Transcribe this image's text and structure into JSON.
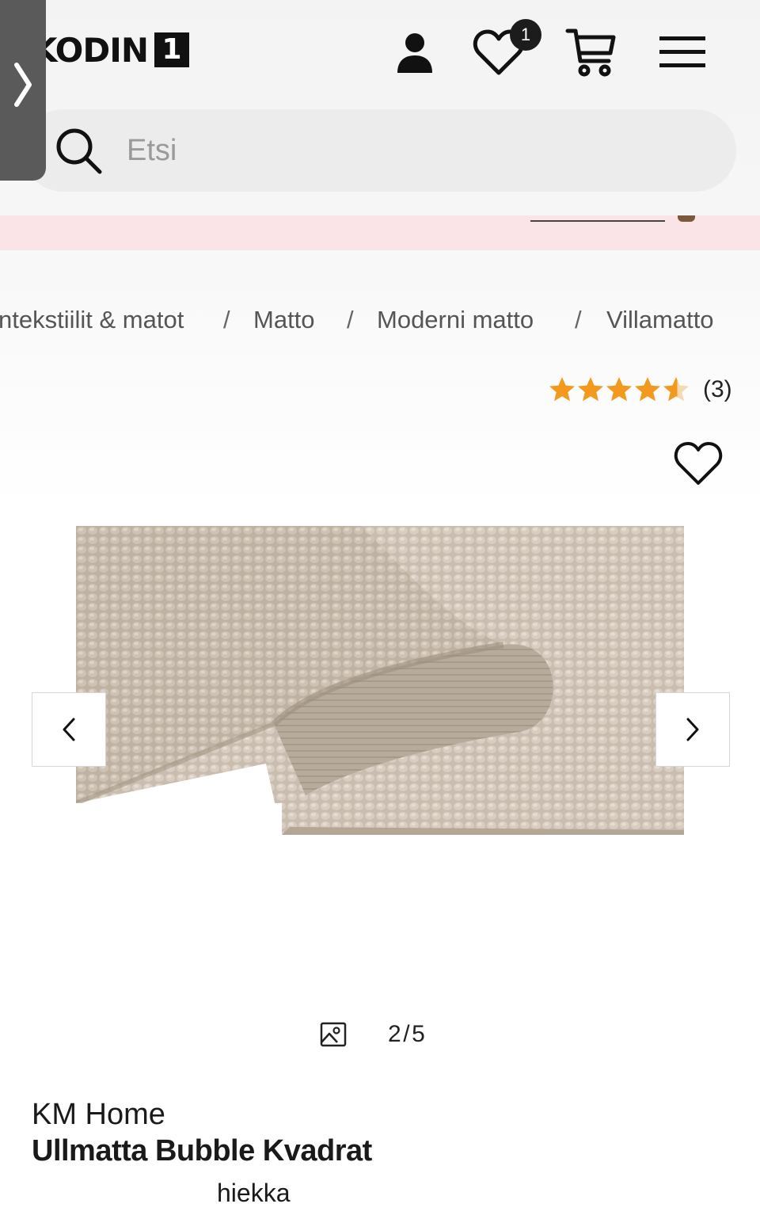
{
  "header": {
    "logo_text": "KODIN",
    "logo_number": "1",
    "wishlist_count": "1",
    "icons": [
      "user-icon",
      "heart-icon",
      "cart-icon",
      "menu-icon",
      "chevron-right-icon"
    ]
  },
  "search": {
    "placeholder": "Etsi"
  },
  "breadcrumb": {
    "items": [
      "ntekstiilit & matot",
      "Matto",
      "Moderni matto",
      "Villamatto"
    ],
    "separator": "/"
  },
  "rating": {
    "stars": 4.5,
    "count": "(3)",
    "star_color": "#f39a1e"
  },
  "gallery": {
    "current": "2",
    "separator": "/",
    "total": "5"
  },
  "product": {
    "brand": "KM Home",
    "title": "Ullmatta Bubble Kvadrat",
    "color": "hiekka"
  },
  "colors": {
    "promo_band": "#fbe4e7",
    "side_tab": "#5a5a5a",
    "search_bg": "#ececec"
  }
}
